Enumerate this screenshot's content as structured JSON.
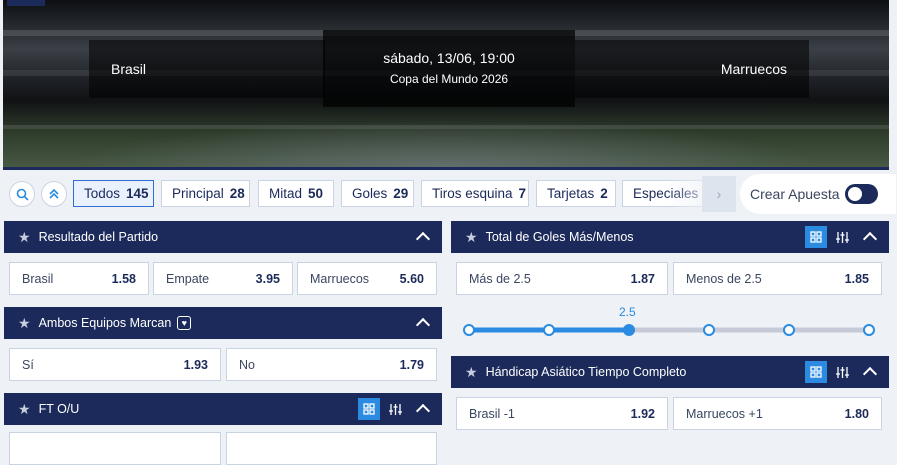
{
  "event": {
    "home_team": "Brasil",
    "away_team": "Marruecos",
    "datetime": "sábado, 13/06, 19:00",
    "competition": "Copa del Mundo 2026"
  },
  "filters": [
    {
      "label": "Todos",
      "count": "145",
      "active": true
    },
    {
      "label": "Principal",
      "count": "28"
    },
    {
      "label": "Mitad",
      "count": "50"
    },
    {
      "label": "Goles",
      "count": "29"
    },
    {
      "label": "Tiros esquina",
      "count": "7"
    },
    {
      "label": "Tarjetas",
      "count": "2"
    },
    {
      "label": "Especiales",
      "count": ""
    }
  ],
  "create_bet_label": "Crear Apuesta",
  "markets": {
    "resultado": {
      "title": "Resultado del Partido",
      "odds": [
        {
          "label": "Brasil",
          "price": "1.58"
        },
        {
          "label": "Empate",
          "price": "3.95"
        },
        {
          "label": "Marruecos",
          "price": "5.60"
        }
      ]
    },
    "ambos": {
      "title": "Ambos Equipos Marcan",
      "odds": [
        {
          "label": "Sí",
          "price": "1.93"
        },
        {
          "label": "No",
          "price": "1.79"
        }
      ]
    },
    "ftou": {
      "title": "FT O/U"
    },
    "total_goles": {
      "title": "Total de Goles Más/Menos",
      "odds": [
        {
          "label": "Más de 2.5",
          "price": "1.87"
        },
        {
          "label": "Menos de 2.5",
          "price": "1.85"
        }
      ],
      "line_value": "2.5",
      "line_index": 2,
      "line_steps": 6
    },
    "handicap": {
      "title": "Hándicap Asiático Tiempo Completo",
      "odds": [
        {
          "label": "Brasil -1",
          "price": "1.92"
        },
        {
          "label": "Marruecos +1",
          "price": "1.80"
        }
      ]
    }
  },
  "colors": {
    "primary": "#1b2a5a",
    "accent": "#2a8be0",
    "slider_active": "#2a8be0",
    "slider_inactive": "#c5cad6"
  }
}
